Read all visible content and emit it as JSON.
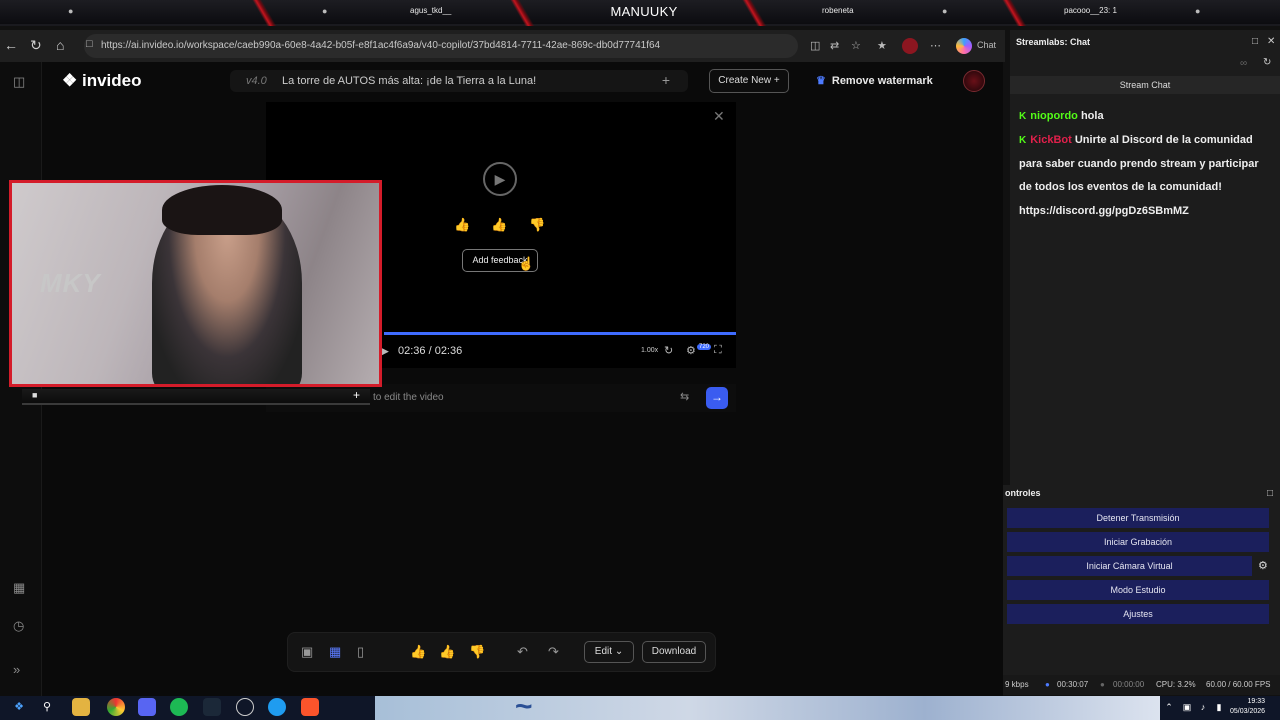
{
  "banner": {
    "main": "MANUUKY",
    "left_a": "agus_tkd__",
    "right_a": "robeneta",
    "right_b": "pacooo__23: 1"
  },
  "browser": {
    "url": "https://ai.invideo.io/workspace/caeb990a-60e8-4a42-b05f-e8f1ac4f6a9a/v40-copilot/37bd4814-7711-42ae-869c-db0d77741f64",
    "copilot_label": "Chat"
  },
  "app": {
    "logo": "invideo",
    "version": "v4.0",
    "project_title": "La torre de AUTOS más alta: ¡de la Tierra a la Luna!",
    "create_new": "Create New",
    "remove_watermark": "Remove watermark"
  },
  "player": {
    "add_feedback": "Add feedback",
    "time": "02:36 / 02:36",
    "progress": 1.0,
    "speed": "1.00x",
    "quality": "720"
  },
  "edit_input": {
    "placeholder": "to edit the video"
  },
  "toolbar": {
    "edit": "Edit",
    "download": "Download"
  },
  "chat": {
    "header": "Streamlabs: Chat",
    "tab": "Stream Chat",
    "messages": [
      {
        "user": "niopordo",
        "text": "hola"
      },
      {
        "user": "KickBot",
        "text": "Unirte al Discord de la comunidad para saber cuando prendo stream y participar de todos los eventos de la comunidad! https://discord.gg/pgDz6SBmMZ"
      }
    ]
  },
  "controls": {
    "header": "ontroles",
    "buttons": [
      "Detener Transmisión",
      "Iniciar Grabación",
      "Iniciar Cámara Virtual",
      "Modo Estudio",
      "Ajustes"
    ]
  },
  "status": {
    "bitrate": "9 kbps",
    "live_time": "00:30:07",
    "rec_time": "00:00:00",
    "cpu": "CPU: 3.2%",
    "fps": "60.00 / 60.00 FPS"
  },
  "clock": {
    "time": "19:33",
    "date": "05/03/2026"
  },
  "icons": {
    "webcam_watermark": "MKY"
  }
}
